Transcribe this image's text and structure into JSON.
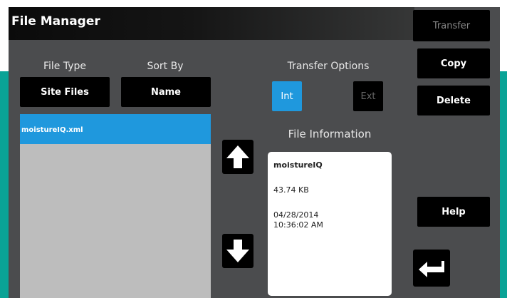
{
  "window": {
    "title": "File Manager"
  },
  "toolbar": {
    "transfer_label": "Transfer",
    "copy_label": "Copy",
    "delete_label": "Delete",
    "help_label": "Help"
  },
  "file_type": {
    "label": "File Type",
    "value": "Site Files"
  },
  "sort_by": {
    "label": "Sort By",
    "value": "Name"
  },
  "transfer_options": {
    "label": "Transfer Options",
    "int_label": "Int",
    "ext_label": "Ext",
    "selected": "Int"
  },
  "file_list": {
    "items": [
      {
        "name": "moistureIQ.xml",
        "selected": true
      }
    ]
  },
  "file_information": {
    "label": "File Information",
    "name": "moistureIQ",
    "size": "43.74 KB",
    "date": "04/28/2014",
    "time": "10:36:02 AM"
  },
  "icons": {
    "up": "arrow-up-icon",
    "down": "arrow-down-icon",
    "enter": "return-arrow-icon"
  },
  "colors": {
    "accent": "#1f98dd",
    "background": "#4b4c4e",
    "bezel_teal": "#0aa396"
  }
}
